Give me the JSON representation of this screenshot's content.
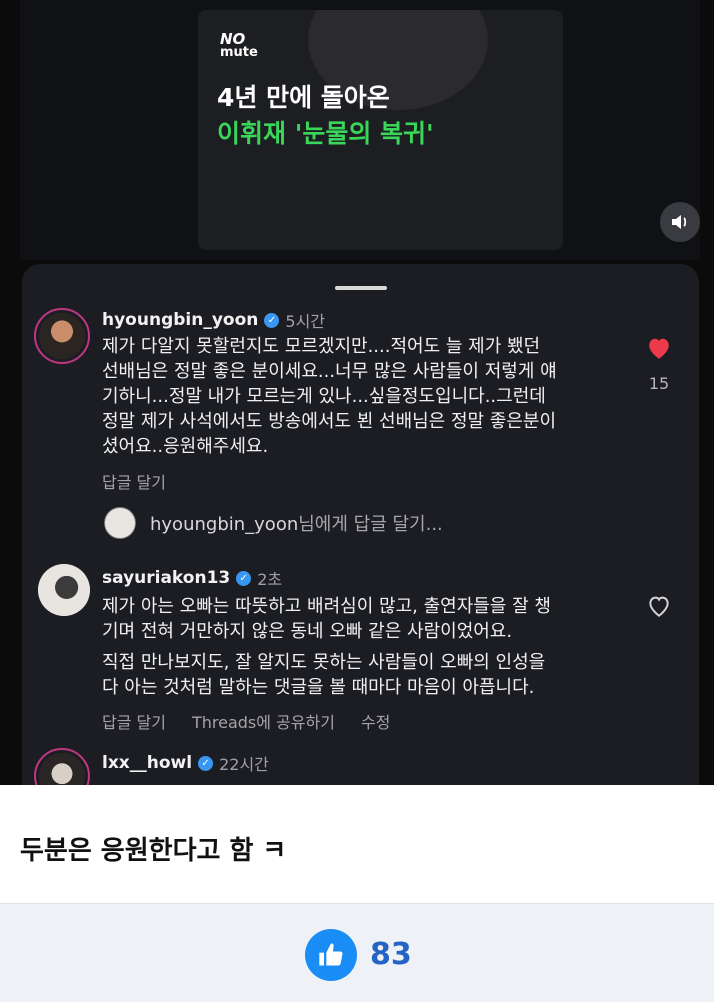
{
  "video": {
    "brand_top": "NO",
    "brand_bottom": "mute",
    "headline_line1": "4년 만에 돌아온",
    "headline_line2": "이휘재 '눈물의 복귀'"
  },
  "comments": [
    {
      "username": "hyoungbin_yoon",
      "time": "5시간",
      "text": "제가 다알지 못할런지도 모르겠지만....적어도 늘 제가 뵀던\n선배님은 정말 좋은 분이세요...너무 많은 사람들이 저렇게 얘\n기하니...정말 내가 모르는게 있나...싶을정도입니다..그런데\n정말 제가 사석에서도 방송에서도 뵌 선배님은 정말 좋은분이\n셨어요..응원해주세요.",
      "reply_label": "답글 달기",
      "like_count": "15",
      "liked": true
    },
    {
      "username": "sayuriakon13",
      "time": "2초",
      "text": "제가 아는 오빠는 따뜻하고 배려심이 많고, 출연자들을 잘 챙\n기며 전혀 거만하지 않은 동네 오빠 같은 사람이었어요.",
      "text2": "직접 만나보지도, 잘 알지도 못하는 사람들이 오빠의 인성을\n다 아는 것처럼 말하는 댓글을 볼 때마다 마음이 아픕니다.",
      "reply_label": "답글 달기",
      "threads_label": "Threads에 공유하기",
      "edit_label": "수정",
      "liked": false
    },
    {
      "username": "lxx__howl",
      "time": "22시간"
    }
  ],
  "reply_prompt": {
    "username": "hyoungbin_yoon",
    "suffix": "님에게 답글 달기..."
  },
  "post": {
    "caption": "두분은 응원한다고 함 ㅋ",
    "like_count": "83"
  },
  "colors": {
    "accent_green": "#39d65a",
    "heart_red": "#ed3a4a",
    "verified_blue": "#3897f0",
    "like_blue": "#1a8cf5"
  }
}
